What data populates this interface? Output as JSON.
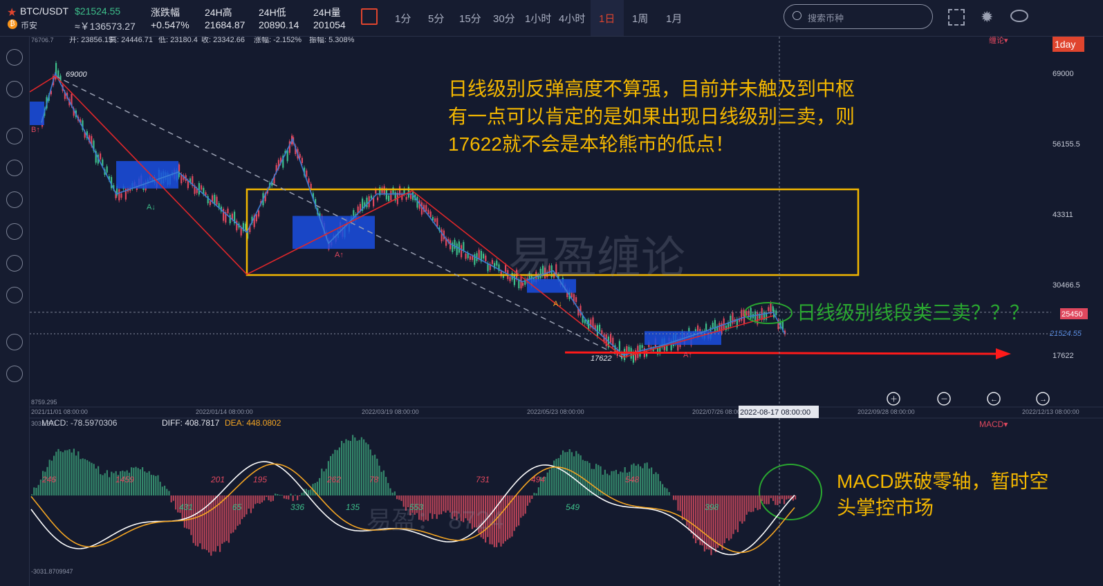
{
  "header": {
    "symbol": "BTC/USDT",
    "price": "$21524.55",
    "exchange": "币安",
    "cny_price": "≈￥136573.27",
    "change_label": "涨跌幅",
    "change_value": "+0.547%",
    "high_label": "24H高",
    "high_value": "21684.87",
    "low_label": "24H低",
    "low_value": "20890.14",
    "vol_label": "24H量",
    "vol_value": "201054",
    "timeframes": [
      "1分",
      "5分",
      "15分",
      "30分",
      "1小时",
      "4小时",
      "1日",
      "1周",
      "1月"
    ],
    "active_timeframe": "1日",
    "search_placeholder": "搜索币种"
  },
  "ohlc": {
    "top_value": "76706.7",
    "open": "开: 23856.15",
    "high": "高: 24446.71",
    "low": "低: 23180.4",
    "close": "收: 23342.66",
    "change": "涨幅: -2.152%",
    "amplitude": "振幅: 5.308%",
    "indicator": "缠论▾",
    "period_badge": "1day",
    "bottom_value": "8759.295"
  },
  "annotations": {
    "main_text": [
      "日线级别反弹高度不算强，目前并未触及到中枢",
      "有一点可以肯定的是如果出现日线级别三卖，则",
      "17622就不会是本轮熊市的低点！"
    ],
    "sell_question": "日线级别线段类三卖？？？",
    "macd_note": [
      "MACD跌破零轴，暂时空",
      "头掌控市场"
    ],
    "watermark": "易盈缠论",
    "watermark2": "易盈：  8724",
    "high_mark": "69000",
    "low_mark": "17622",
    "signal_buy": "B↑",
    "signal_a": "A↓",
    "signal_a_up": "A↑"
  },
  "macd": {
    "top_value": "3031.871",
    "macd_label": "MACD: -78.5970306",
    "diff_label": "DIFF: 408.7817",
    "dea_label": "DEA: 448.0802",
    "bottom_value": "-3031.8709947",
    "indicator": "MACD▾",
    "hist_labels_pos": [
      "246",
      "1459",
      "201",
      "195",
      "262",
      "78",
      "731",
      "494",
      "548"
    ],
    "hist_labels_neg": [
      "431",
      "65",
      "336",
      "135",
      "553",
      "549",
      "398"
    ]
  },
  "colors": {
    "bg": "#141a2e",
    "up": "#3dbf8a",
    "down": "#e0485e",
    "accent": "#f5a623",
    "zs": "#1a4fe0",
    "stroke_red": "#e0272a",
    "stroke_blue": "#3a7bd5"
  },
  "chart_data": {
    "type": "line",
    "title": "",
    "xlabel": "",
    "ylabel": "",
    "x": [
      "2021/11/01",
      "2022/01/14",
      "2022/03/19",
      "2022/05/23",
      "2022/07/26",
      "2022-08-17",
      "2022/09/28",
      "2022/12/13"
    ],
    "ylim": [
      8759.295,
      76706.7
    ],
    "y_ticks": [
      69000,
      56155.5,
      43311,
      30466.5,
      17622
    ],
    "current_price": 21524.55,
    "crosshair_price": 25450,
    "crosshair_date": "2022-08-17 08:00:00",
    "series": [
      {
        "values": [
          60000,
          69000,
          47000,
          51000,
          40000,
          57000,
          38000,
          47000,
          47000,
          38000,
          31000,
          33000,
          23500,
          17622,
          19500,
          22000,
          24500,
          25450,
          21500
        ]
      }
    ],
    "zhongshu": [
      {
        "low": 48000,
        "high": 53000
      },
      {
        "low": 37000,
        "high": 43000
      },
      {
        "low": 29000,
        "high": 31500
      },
      {
        "low": 19500,
        "high": 22000
      }
    ],
    "big_zhongshu": {
      "low": 32000,
      "high": 48000
    },
    "macd_hist_range": [
      -3031.8709947,
      3031.871
    ]
  }
}
